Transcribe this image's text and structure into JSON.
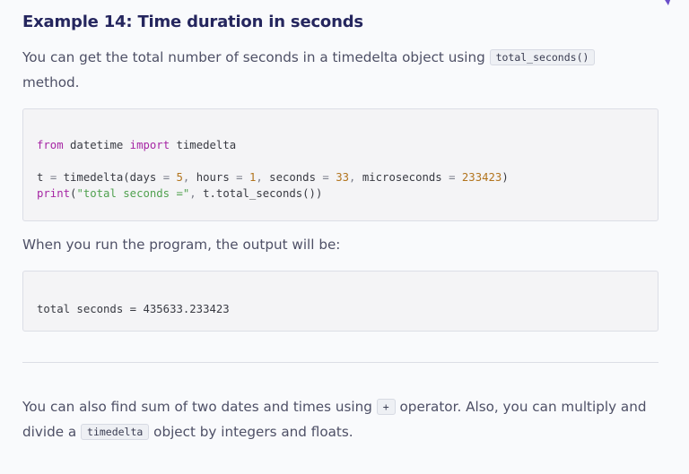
{
  "heading": "Example 14: Time duration in seconds",
  "intro": {
    "before": "You can get the total number of seconds in a timedelta object using ",
    "code": "total_seconds()",
    "after": " method."
  },
  "code1": {
    "line1": {
      "kw1": "from",
      "mod": " datetime ",
      "kw2": "import",
      "name": " timedelta"
    },
    "line3": {
      "p1": "t ",
      "eq1": "=",
      "p2": " timedelta(days ",
      "eq2": "=",
      "n1": " 5",
      "c1": ",",
      "p3": " hours ",
      "eq3": "=",
      "n2": " 1",
      "c2": ",",
      "p4": " seconds ",
      "eq4": "=",
      "n3": " 33",
      "c3": ",",
      "p5": " microseconds ",
      "eq5": "=",
      "n4": " 233423",
      "end": ")"
    },
    "line4": {
      "fn": "print",
      "open": "(",
      "str": "\"total seconds =\"",
      "c": ",",
      "rest": " t.total_seconds())"
    }
  },
  "output_intro": "When you run the program, the output will be:",
  "output": "total seconds = 435633.233423",
  "outro": {
    "p1": "You can also find sum of two dates and times using ",
    "code1": "+",
    "p2": " operator. Also, you can multiply and divide a ",
    "code2": "timedelta",
    "p3": " object by integers and floats."
  }
}
